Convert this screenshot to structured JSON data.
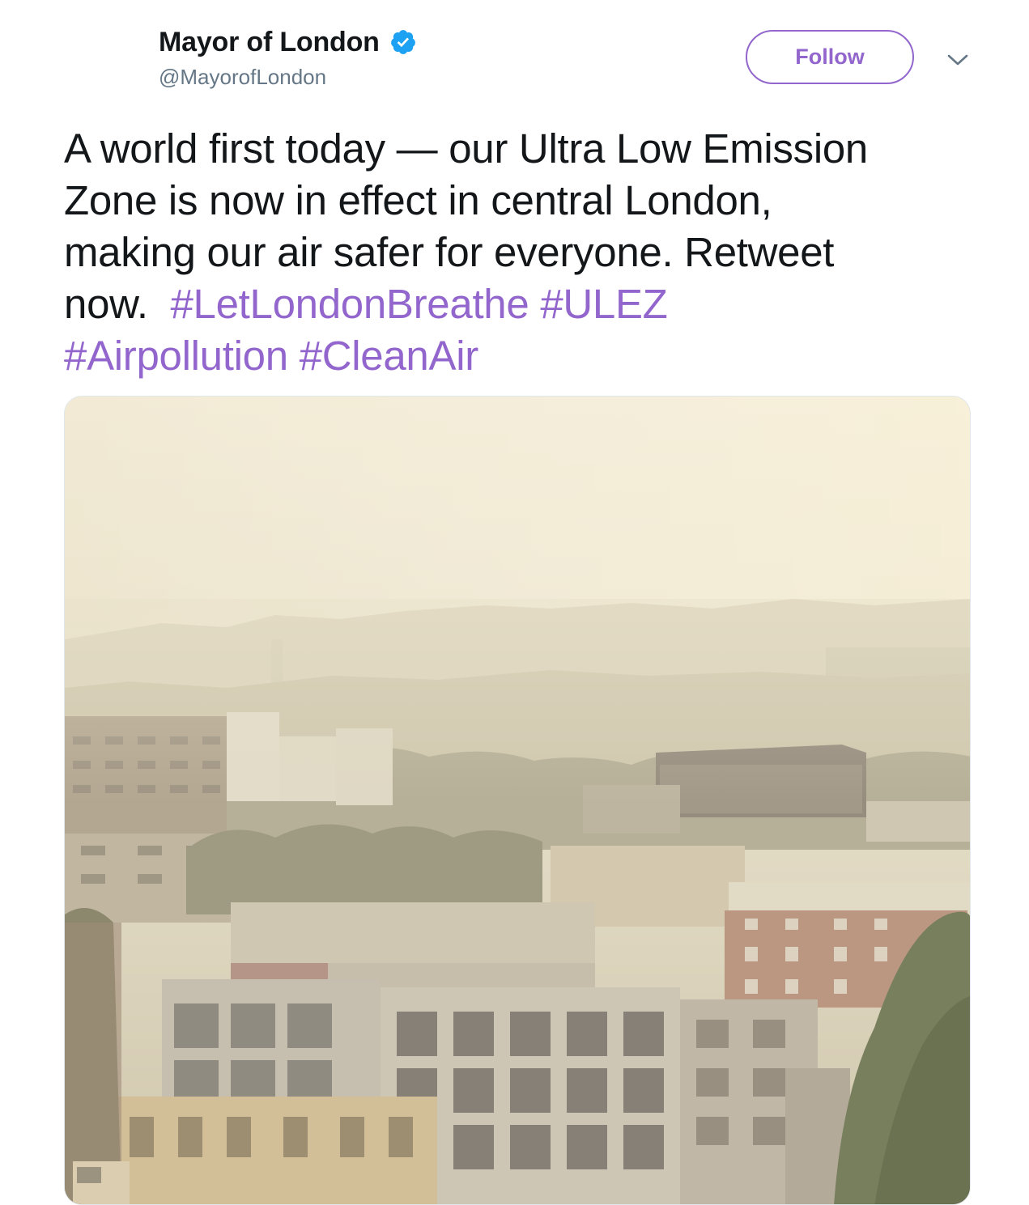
{
  "tweet": {
    "display_name": "Mayor of London",
    "handle": "@MayorofLondon",
    "verified_badge_icon": "verified-badge-icon",
    "follow_label": "Follow",
    "caret_icon": "chevron-down-icon",
    "text_lines": [
      [
        "A world first today — our Ultra Low Emission"
      ],
      [
        "Zone is now in effect in central London,"
      ],
      [
        "making our air safer for everyone. Retweet"
      ]
    ],
    "line4_text": "now.",
    "hashtags": [
      "#LetLondonBreathe",
      "#ULEZ",
      "#Airpollution",
      "#CleanAir"
    ],
    "media_alt_icon": "photo-icon"
  },
  "colors": {
    "accent": "#9266cc",
    "verified": "#1da1f2",
    "text": "#14171a",
    "secondary": "#657786",
    "border": "#e1e8ed"
  }
}
